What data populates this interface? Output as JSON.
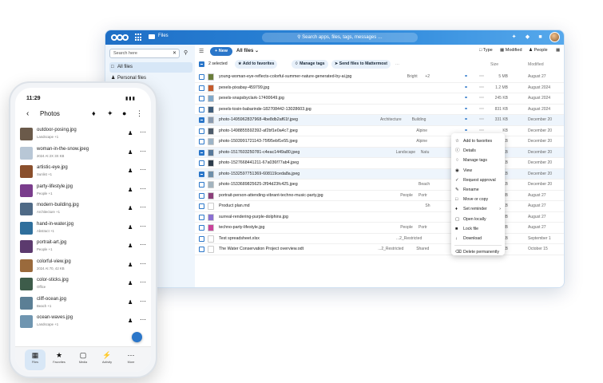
{
  "colors": {
    "brand": "#1f6fc6",
    "accent": "#2a76c9",
    "selected_row": "#eef5fc"
  },
  "desktop": {
    "app_name": "Files",
    "search_placeholder": "Search apps, files, tags, messages …",
    "sidebar": {
      "search_placeholder": "Search here",
      "items": [
        {
          "label": "All files",
          "icon": "folder-icon"
        },
        {
          "label": "Personal files",
          "icon": "user-icon"
        }
      ]
    },
    "toolbar": {
      "new_label": "New",
      "breadcrumb": "All files",
      "view_type": "Type",
      "view_modified": "Modified",
      "view_people": "People"
    },
    "selection": {
      "count_label": "2 selected",
      "add_favorites": "Add to favorites",
      "manage_tags": "Manage tags",
      "send_files": "Send files to Mattermost",
      "size_header": "Size",
      "modified_header": "Modified"
    },
    "rows": [
      {
        "name": "young-woman-eye-reflects-colorful-summer-nature-generated-by-ai.jpg",
        "tags": [
          "Bright",
          "+2"
        ],
        "size": "5 MB",
        "modified": "August 27",
        "selected": false,
        "thumb": "#6a7d3a"
      },
      {
        "name": "pexels-pixabay-459799.jpg",
        "tags": [],
        "size": "1.2 MB",
        "modified": "August 2024",
        "selected": false,
        "thumb": "#c55a2b"
      },
      {
        "name": "pexels-snapsbyclark-17400649.jpg",
        "tags": [],
        "size": "245 KB",
        "modified": "August 2024",
        "selected": false,
        "thumb": "#7fa8c9"
      },
      {
        "name": "pexels-tosin-babarinde-182708442-13028603.jpg",
        "tags": [],
        "size": "831 KB",
        "modified": "August 2024",
        "selected": false,
        "thumb": "#3e5c7a"
      },
      {
        "name": "photo-1495962837968-4be8db2af61f.jpeg",
        "tags": [
          "Architecture",
          "Building"
        ],
        "size": "331 KB",
        "modified": "December 20",
        "selected": true,
        "thumb": "#8a9bb0"
      },
      {
        "name": "photo-1498855592392-af2bf1e0a4c7.jpeg",
        "tags": [
          "Alpine"
        ],
        "size": "KB",
        "modified": "December 20",
        "selected": false,
        "thumb": "#4d5b6a"
      },
      {
        "name": "photo-1503991721143-75f95ebf1e55.jpeg",
        "tags": [
          "Alpine"
        ],
        "size": "KB",
        "modified": "December 20",
        "selected": false,
        "thumb": "#9cb3c6"
      },
      {
        "name": "photo-1517603250781-c4eac1449a80.jpeg",
        "tags": [
          "Landscape",
          "Natu"
        ],
        "size": "KB",
        "modified": "December 20",
        "selected": true,
        "thumb": "#56789a"
      },
      {
        "name": "photo-1527668441211-67a036f77ab4.jpeg",
        "tags": [],
        "size": "KB",
        "modified": "December 20",
        "selected": false,
        "thumb": "#2e3d4c"
      },
      {
        "name": "photo-1532597751369-608119ceda8a.jpeg",
        "tags": [],
        "size": "KB",
        "modified": "December 20",
        "selected": true,
        "thumb": "#6d8faa"
      },
      {
        "name": "photo-1533689825625-2f94d23fc425.jpeg",
        "tags": [
          "Beach"
        ],
        "size": "KB",
        "modified": "December 20",
        "selected": false,
        "thumb": "#a3b4bf"
      },
      {
        "name": "portrait-person-attending-vibrant-techno-music-party.jpg",
        "tags": [
          "People",
          "Portr"
        ],
        "size": "MB",
        "modified": "August 27",
        "selected": false,
        "thumb": "#8c3f7a"
      },
      {
        "name": "Product plan.md",
        "tags": [
          "Sh"
        ],
        "size": "KB",
        "modified": "August 27",
        "selected": false,
        "thumb": "#ffffff"
      },
      {
        "name": "surreal-rendering-purple-dolphins.jpg",
        "tags": [],
        "size": "MB",
        "modified": "August 27",
        "selected": false,
        "thumb": "#8a6fd1"
      },
      {
        "name": "techno-party-lifestyle.jpg",
        "tags": [
          "People",
          "Portr"
        ],
        "size": "MB",
        "modified": "August 27",
        "selected": false,
        "thumb": "#c9439a"
      },
      {
        "name": "Test spreadsheet.xlsx",
        "tags": [
          "...2_Restricted"
        ],
        "size": "6 KB",
        "modified": "September 1",
        "selected": false,
        "thumb": "#ffffff"
      },
      {
        "name": "The Water Conservation Project overview.odt",
        "tags": [
          "...2_Restricted",
          "Shared"
        ],
        "size": "406 KB",
        "modified": "October 15",
        "selected": false,
        "thumb": "#ffffff"
      }
    ],
    "context_menu": [
      {
        "label": "Add to favorites",
        "icon": "star-icon"
      },
      {
        "label": "Details",
        "icon": "info-icon"
      },
      {
        "label": "Manage tags",
        "icon": "tag-icon"
      },
      {
        "label": "View",
        "icon": "eye-icon"
      },
      {
        "label": "Request approval",
        "icon": "check-icon"
      },
      {
        "label": "Rename",
        "icon": "pencil-icon"
      },
      {
        "label": "Move or copy",
        "icon": "folder-move-icon"
      },
      {
        "label": "Set reminder",
        "icon": "bell-icon"
      },
      {
        "label": "Open locally",
        "icon": "open-icon"
      },
      {
        "label": "Lock file",
        "icon": "lock-icon"
      },
      {
        "label": "Download",
        "icon": "download-icon"
      },
      {
        "label": "Delete permanently",
        "icon": "trash-icon"
      }
    ]
  },
  "phone": {
    "time": "11:29",
    "title": "Photos",
    "items": [
      {
        "name": "outdoor-posing.jpg",
        "meta": "Landscape  +1",
        "thumb": "#6b5a4a"
      },
      {
        "name": "woman-in-the-snow.jpeg",
        "meta": "2024 At 2X 3X KB",
        "thumb": "#b8c7d6"
      },
      {
        "name": "artistic-eye.jpg",
        "meta": "Sunlist  +1",
        "thumb": "#8a4f2c"
      },
      {
        "name": "party-lifestyle.jpg",
        "meta": "People  +1",
        "thumb": "#7a3d8c"
      },
      {
        "name": "modern-building.jpg",
        "meta": "Architecture  +1",
        "thumb": "#4f6a86"
      },
      {
        "name": "hand-in-water.jpg",
        "meta": "Abstract  +1",
        "thumb": "#2f6f9c"
      },
      {
        "name": "portrait-art.jpg",
        "meta": "People  +1",
        "thumb": "#5c3a6e"
      },
      {
        "name": "colorful-view.jpg",
        "meta": "2024 At 70, 42 KB",
        "thumb": "#9a6a3c"
      },
      {
        "name": "color-sticks.jpg",
        "meta": "Office",
        "thumb": "#3d5c4a"
      },
      {
        "name": "cliff-ocean.jpg",
        "meta": "Beach  +1",
        "thumb": "#5b7f95"
      },
      {
        "name": "ocean-waves.jpg",
        "meta": "Landscape  +1",
        "thumb": "#6f95b0"
      }
    ],
    "nav": [
      {
        "label": "Files",
        "icon": "folder-icon"
      },
      {
        "label": "Favorites",
        "icon": "star-icon"
      },
      {
        "label": "Media",
        "icon": "image-icon"
      },
      {
        "label": "Activity",
        "icon": "activity-icon"
      },
      {
        "label": "More",
        "icon": "more-icon"
      }
    ]
  }
}
